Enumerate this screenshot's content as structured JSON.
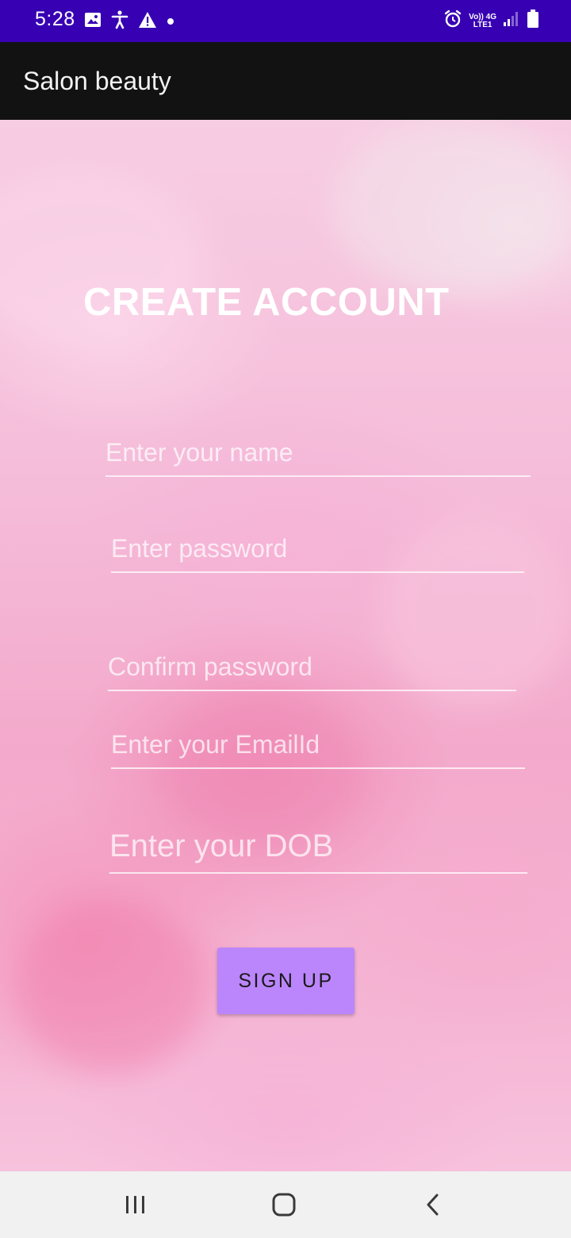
{
  "status_bar": {
    "time": "5:28",
    "network_top": "Vo)) 4G",
    "network_bottom": "LTE1",
    "icons": [
      "image-icon",
      "accessibility-icon",
      "warning-icon",
      "dot-icon",
      "alarm-icon",
      "signal-icon",
      "battery-icon"
    ],
    "background_color": "#3700b3"
  },
  "app_bar": {
    "title": "Salon beauty",
    "background_color": "#121212"
  },
  "form": {
    "heading": "CREATE ACCOUNT",
    "name_placeholder": "Enter your name",
    "password_placeholder": "Enter password",
    "confirm_password_placeholder": "Confirm password",
    "email_placeholder": "Enter your EmailId",
    "dob_placeholder": "Enter your DOB",
    "signup_label": "SIGN UP",
    "button_color": "#bb86fc"
  },
  "nav_bar": {
    "icons": [
      "recents-icon",
      "home-icon",
      "back-icon"
    ]
  }
}
